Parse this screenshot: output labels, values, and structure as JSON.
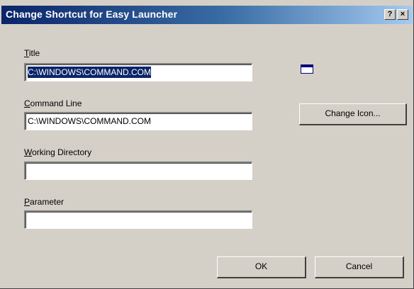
{
  "window": {
    "title": "Change Shortcut for Easy Launcher",
    "help_label": "?",
    "close_label": "×"
  },
  "fields": {
    "title": {
      "label_underlined": "T",
      "label_rest": "itle",
      "value": "C:\\WINDOWS\\COMMAND.COM"
    },
    "command_line": {
      "label_underlined": "C",
      "label_rest": "ommand Line",
      "value": "C:\\WINDOWS\\COMMAND.COM"
    },
    "working_directory": {
      "label_underlined": "W",
      "label_rest": "orking Directory",
      "value": ""
    },
    "parameter": {
      "label_underlined": "P",
      "label_rest": "arameter",
      "value": ""
    }
  },
  "buttons": {
    "change_icon": "Change Icon...",
    "ok": "OK",
    "cancel": "Cancel"
  },
  "icon": {
    "name": "window-icon"
  },
  "colors": {
    "titlebar_start": "#0a246a",
    "titlebar_end": "#a6caf0",
    "dialog_face": "#d4d0c8",
    "selection": "#0a246a"
  }
}
